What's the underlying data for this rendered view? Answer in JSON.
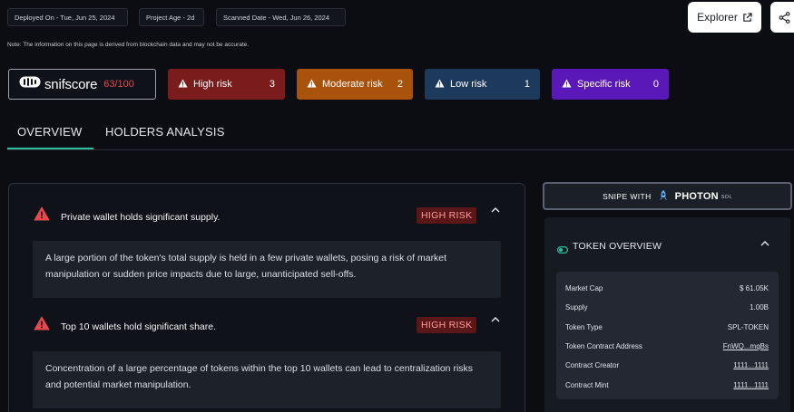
{
  "meta": {
    "deployed": "Deployed On - Tue, Jun 25, 2024",
    "age": "Project Age - 2d",
    "scanned": "Scanned Date - Wed, Jun 26, 2024",
    "note": "Note: The information on this page is derived from blockchain data and may not be accurate."
  },
  "actions": {
    "explorer_label": "Explorer",
    "explorer_icon": "external-link-icon",
    "share_icon": "share-icon"
  },
  "score": {
    "brand": "snifscore",
    "value": "63/100",
    "value_color": "#e5484d"
  },
  "risks": [
    {
      "label": "High risk",
      "count": "3",
      "color": "#7a1c1c"
    },
    {
      "label": "Moderate risk",
      "count": "2",
      "color": "#a9520c"
    },
    {
      "label": "Low risk",
      "count": "1",
      "color": "#1d3a5c"
    },
    {
      "label": "Specific risk",
      "count": "0",
      "color": "#5a18b8"
    }
  ],
  "tabs": [
    {
      "label": "OVERVIEW",
      "active": true
    },
    {
      "label": "HOLDERS ANALYSIS",
      "active": false
    }
  ],
  "issues": [
    {
      "title": "Private wallet holds significant supply.",
      "badge": "HIGH RISK",
      "desc": "A large portion of the token's total supply is held in a few private wallets, posing a risk of market manipulation or sudden price impacts due to large, unanticipated sell-offs."
    },
    {
      "title": "Top 10 wallets hold significant share.",
      "badge": "HIGH RISK",
      "desc": "Concentration of a large percentage of tokens within the top 10 wallets can lead to centralization risks and potential market manipulation."
    }
  ],
  "snipe": {
    "prefix": "SNIPE WITH",
    "brand": "PHOTON",
    "suffix": "SOL"
  },
  "token_overview": {
    "title": "TOKEN OVERVIEW",
    "rows": [
      {
        "label": "Market Cap",
        "value": "$ 61.05K",
        "link": false
      },
      {
        "label": "Supply",
        "value": "1.00B",
        "link": false
      },
      {
        "label": "Token Type",
        "value": "SPL-TOKEN",
        "link": false
      },
      {
        "label": "Token Contract Address",
        "value": "FnWQ...mqBs",
        "link": true
      },
      {
        "label": "Contract Creator",
        "value": "1111...1111",
        "link": true
      },
      {
        "label": "Contract Mint",
        "value": "1111...1111",
        "link": true
      }
    ]
  },
  "colors": {
    "accent": "#2fbf9d",
    "high_badge_bg": "#5b1717",
    "high_badge_text": "#ff9c9c",
    "warn_red": "#e5484d"
  }
}
